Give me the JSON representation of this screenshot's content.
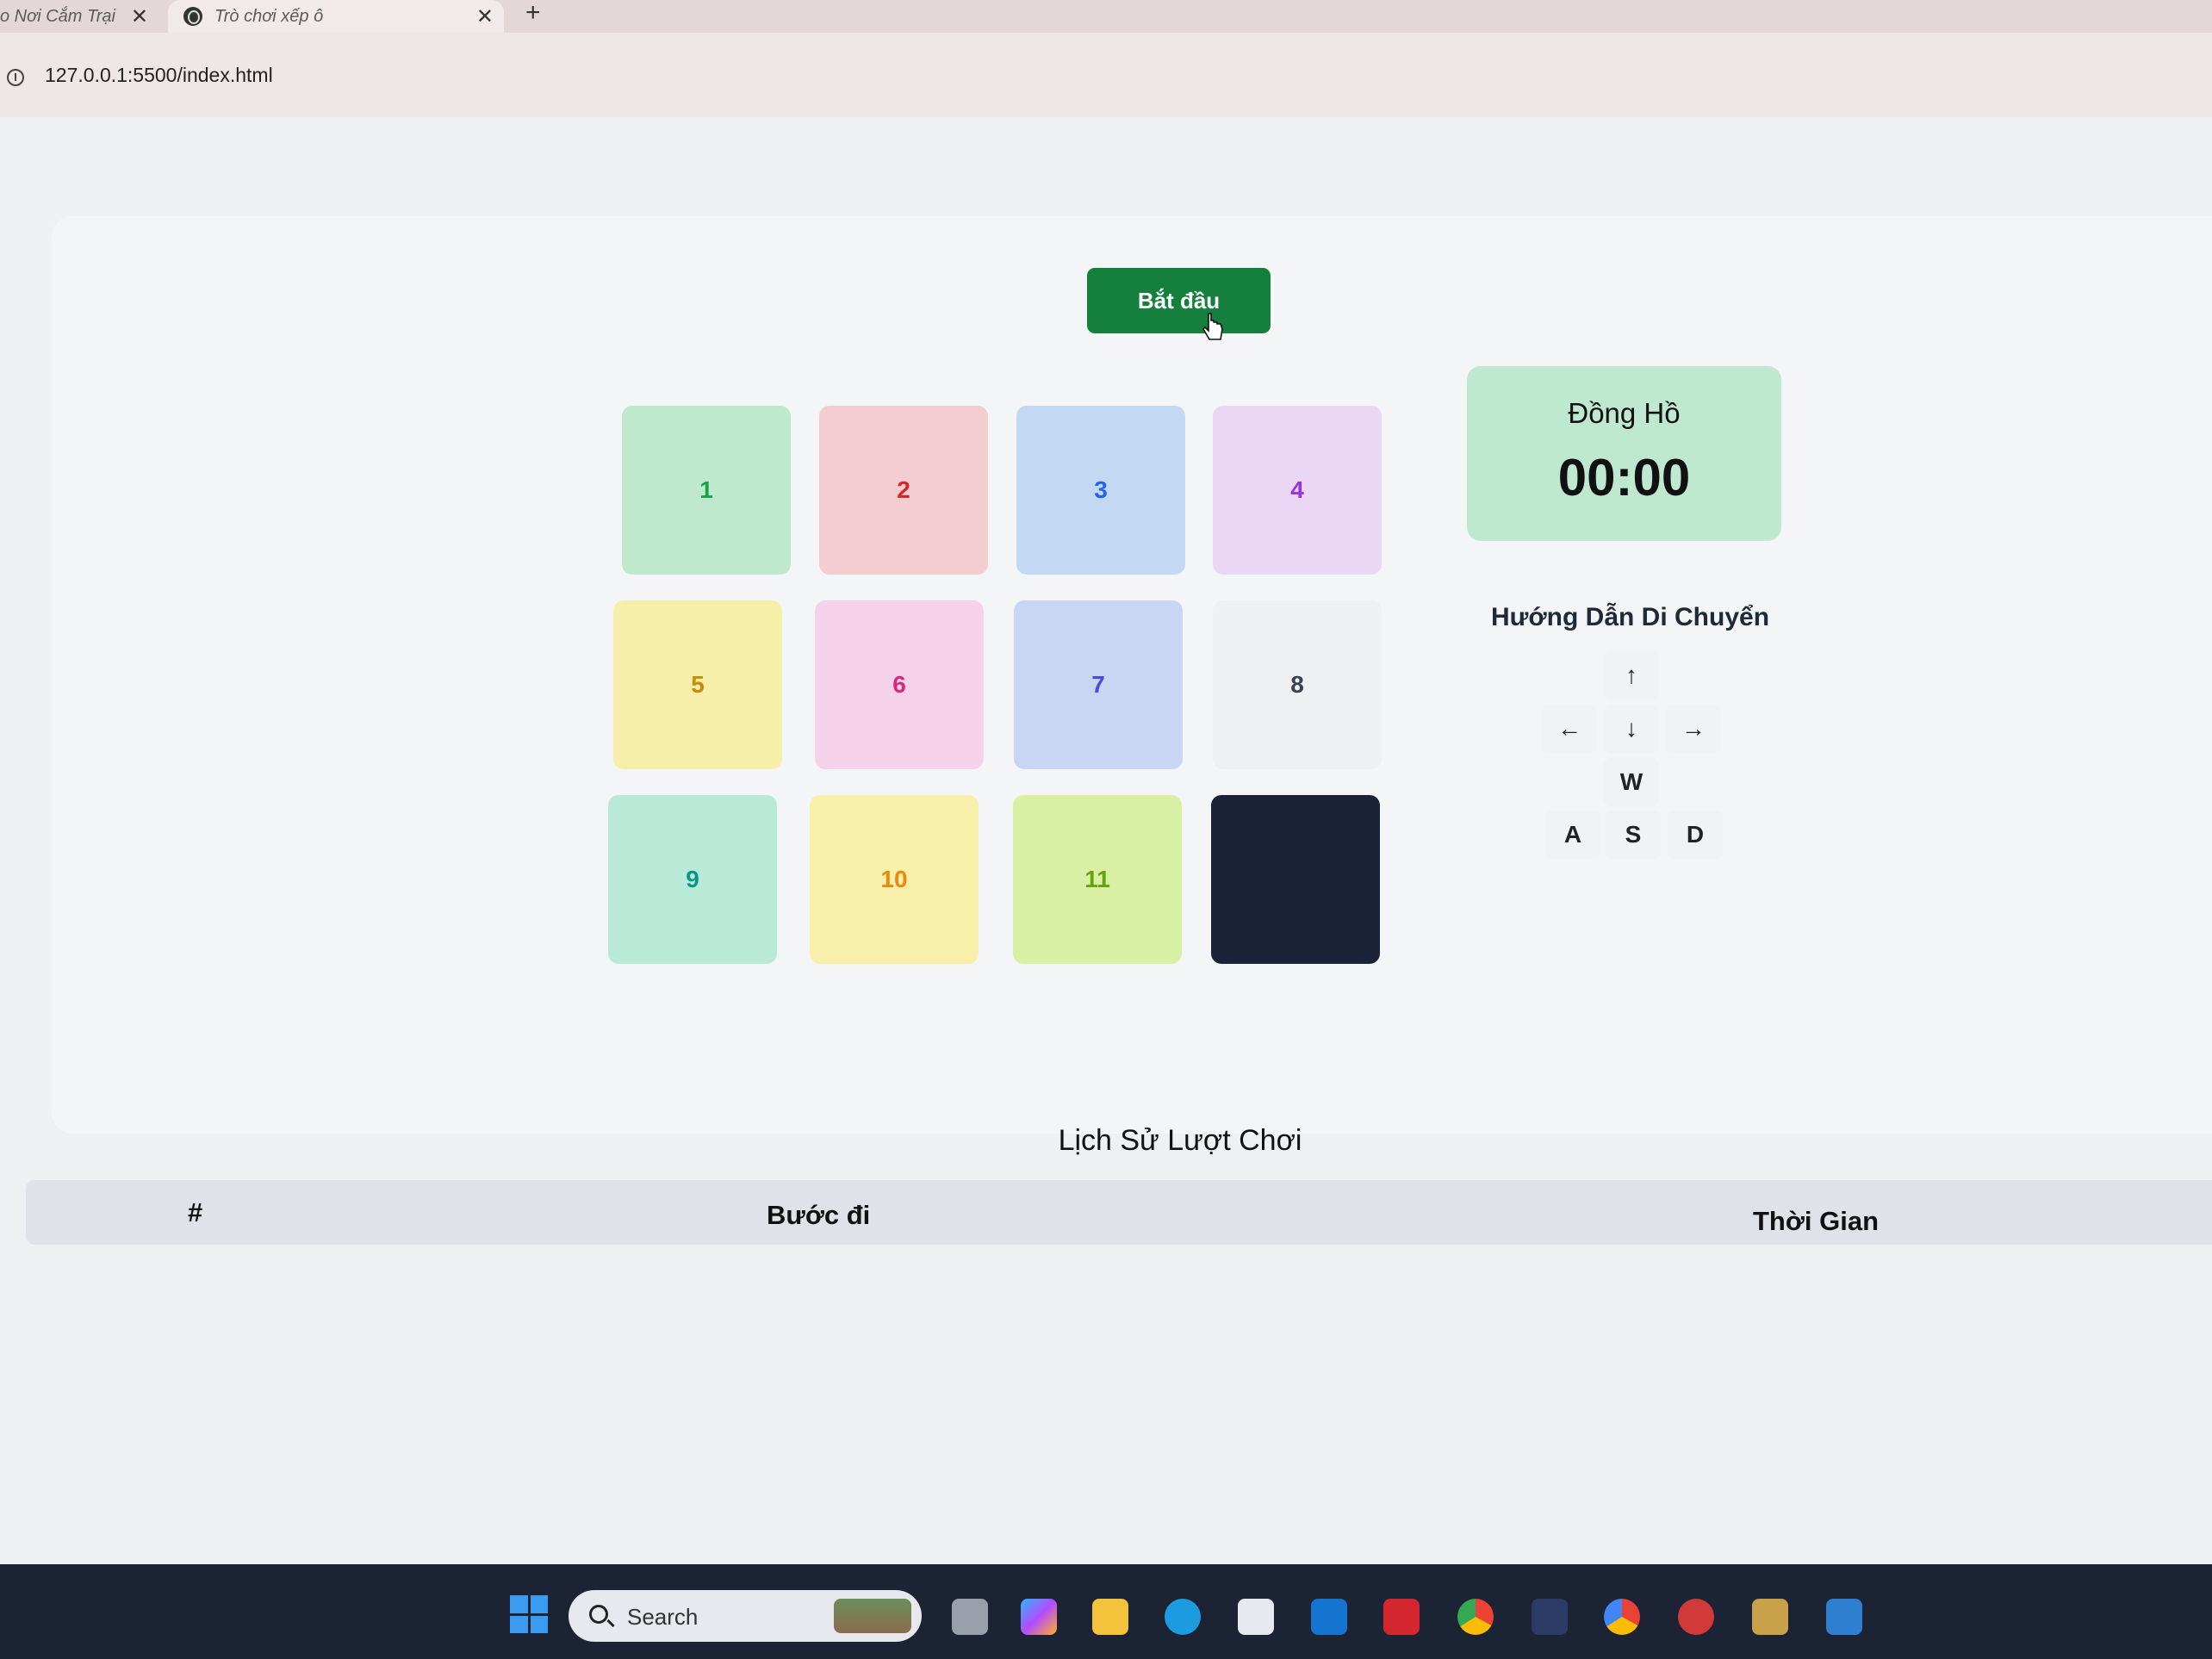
{
  "browser": {
    "prev_tab_title": "o Nơi Cắm Trại",
    "active_tab_title": "Trò chơi xếp ô",
    "close_symbol": "✕",
    "new_tab_symbol": "+",
    "url": "127.0.0.1:5500/index.html"
  },
  "game": {
    "start_label": "Bắt đầu",
    "tiles": [
      {
        "label": "1",
        "bg": "#bfe9cd",
        "fg": "#16a34a"
      },
      {
        "label": "2",
        "bg": "#f3cdd1",
        "fg": "#dc2626"
      },
      {
        "label": "3",
        "bg": "#c3d8f3",
        "fg": "#2563eb"
      },
      {
        "label": "4",
        "bg": "#ead6f5",
        "fg": "#9333ea"
      },
      {
        "label": "5",
        "bg": "#f6efaa",
        "fg": "#ca8a04"
      },
      {
        "label": "6",
        "bg": "#f6d2ea",
        "fg": "#db2777"
      },
      {
        "label": "7",
        "bg": "#c8d6f4",
        "fg": "#4f46e5"
      },
      {
        "label": "8",
        "bg": "#eff0f2",
        "fg": "#374151"
      },
      {
        "label": "9",
        "bg": "#b9ead8",
        "fg": "#0d9488"
      },
      {
        "label": "10",
        "bg": "#f8efab",
        "fg": "#ea8a0c"
      },
      {
        "label": "11",
        "bg": "#d9efa4",
        "fg": "#65a30d"
      },
      {
        "label": "",
        "bg": "#1b2238",
        "fg": "#ffffff"
      }
    ]
  },
  "clock": {
    "title": "Đồng Hồ",
    "time": "00:00"
  },
  "guide": {
    "title": "Hướng Dẫn Di Chuyển",
    "keys": {
      "up": "↑",
      "left": "←",
      "down": "↓",
      "right": "→",
      "w": "W",
      "a": "A",
      "s": "S",
      "d": "D"
    }
  },
  "history": {
    "title": "Lịch Sử Lượt Chơi",
    "columns": [
      "#",
      "Bước đi",
      "Thời Gian"
    ]
  },
  "taskbar": {
    "search_placeholder": "Search"
  }
}
